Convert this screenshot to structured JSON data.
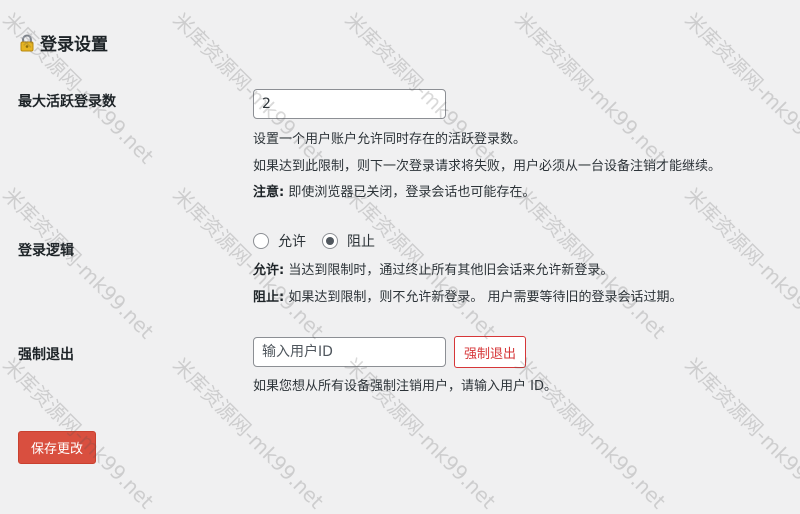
{
  "section": {
    "title": "登录设置",
    "icon": "lock-icon"
  },
  "max_sessions": {
    "label": "最大活跃登录数",
    "value": "2",
    "desc1": "设置一个用户账户允许同时存在的活跃登录数。",
    "desc2": "如果达到此限制，则下一次登录请求将失败，用户必须从一台设备注销才能继续。",
    "note_label": "注意:",
    "note_text": " 即使浏览器已关闭，登录会话也可能存在。"
  },
  "login_logic": {
    "label": "登录逻辑",
    "options": [
      {
        "label": "允许",
        "checked": false
      },
      {
        "label": "阻止",
        "checked": true
      }
    ],
    "allow_label": "允许:",
    "allow_text": " 当达到限制时，通过终止所有其他旧会话来允许新登录。",
    "block_label": "阻止:",
    "block_text": " 如果达到限制，则不允许新登录。 用户需要等待旧的登录会话过期。"
  },
  "force_logout": {
    "label": "强制退出",
    "placeholder": "输入用户ID",
    "button": "强制退出",
    "desc": "如果您想从所有设备强制注销用户，请输入用户 ID。"
  },
  "save_button": "保存更改",
  "watermark": "米库资源网-mk99.net",
  "colors": {
    "accent": "#d94f3f",
    "danger": "#d63638",
    "background": "#f0f0f1"
  }
}
